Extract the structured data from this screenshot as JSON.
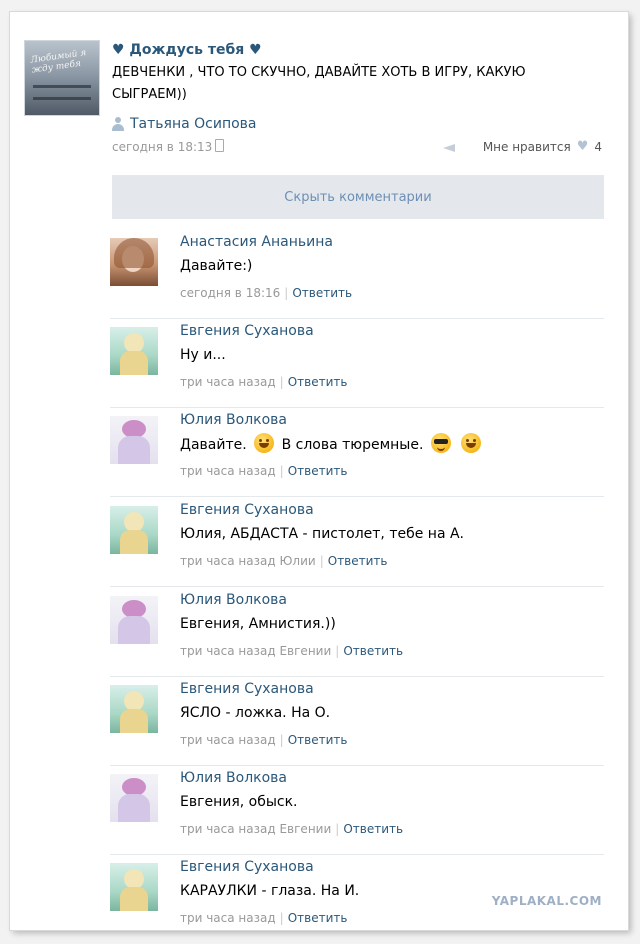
{
  "post": {
    "title": "♥ Дождусь тебя ♥",
    "text": "ДЕВЧЕНКИ , ЧТО ТО СКУЧНО, ДАВАЙТЕ ХОТЬ В ИГРУ, КАКУЮ СЫГРАЕМ))",
    "author": "Татьяна Осипова",
    "time": "сегодня в 18:13",
    "like_label": "Мне нравится",
    "like_count": "4",
    "avatar_caption": "Любимый я жду тебя"
  },
  "hide_comments_label": "Скрыть комментарии",
  "comments": [
    {
      "name": "Анастасия Ананьина",
      "text": "Давайте:)",
      "time": "сегодня в 18:16",
      "reply": "Ответить",
      "avatar": "girl-photo"
    },
    {
      "name": "Евгения Суханова",
      "text": "Ну и...",
      "time": "три часа назад",
      "reply": "Ответить",
      "avatar": "angel-figure"
    },
    {
      "name": "Юлия Волкова",
      "text_a": "Давайте.",
      "text_b": "В слова тюремные.",
      "time": "три часа назад",
      "reply": "Ответить",
      "avatar": "pink-bear",
      "emoji": [
        "grin-emoji",
        "sunglasses-emoji",
        "grin-emoji"
      ]
    },
    {
      "name": "Евгения Суханова",
      "text": "Юлия, АБДАСТА - пистолет, тебе на А.",
      "time": "три часа назад Юлии",
      "reply": "Ответить",
      "avatar": "angel-figure"
    },
    {
      "name": "Юлия Волкова",
      "text": "Евгения, Амнистия.))",
      "time": "три часа назад Евгении",
      "reply": "Ответить",
      "avatar": "pink-bear"
    },
    {
      "name": "Евгения Суханова",
      "text": "ЯСЛО - ложка. На О.",
      "time": "три часа назад",
      "reply": "Ответить",
      "avatar": "angel-figure"
    },
    {
      "name": "Юлия Волкова",
      "text": "Евгения, обыск.",
      "time": "три часа назад Евгении",
      "reply": "Ответить",
      "avatar": "pink-bear"
    },
    {
      "name": "Евгения Суханова",
      "text": "КАРАУЛКИ - глаза. На И.",
      "time": "три часа назад",
      "reply": "Ответить",
      "avatar": "angel-figure"
    }
  ],
  "watermark": "YAPLAKAL.COM",
  "colors": {
    "link": "#2b587a",
    "muted": "#999999",
    "bar": "#e4e8ed"
  }
}
